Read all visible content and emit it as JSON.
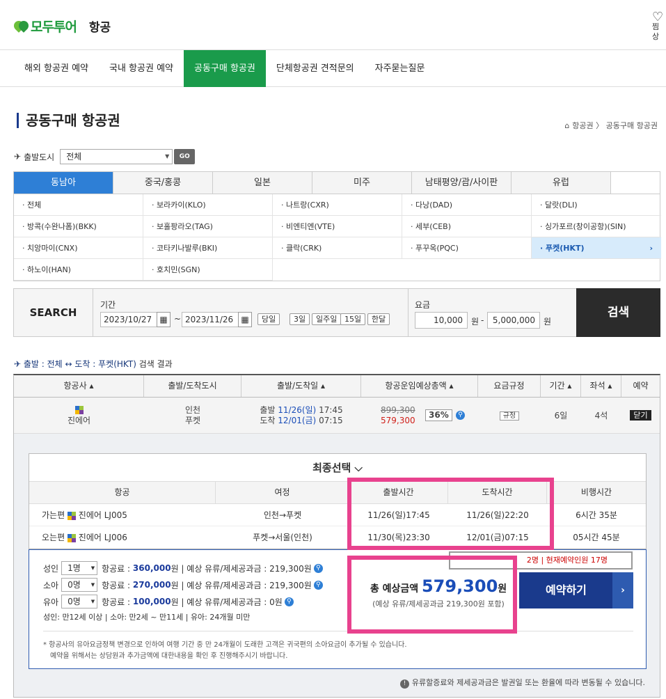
{
  "header": {
    "logo": "모두투어",
    "sub": "항공",
    "wish_label": "찜상"
  },
  "gnb": [
    "해외 항공권 예약",
    "국내 항공권 예약",
    "공동구매 항공권",
    "단체항공권 견적문의",
    "자주묻는질문"
  ],
  "page_title": "공동구매 항공권",
  "breadcrumb": {
    "home": "⌂",
    "path": "항공권 〉 공동구매 항공권"
  },
  "city": {
    "label": "출발도시",
    "value": "전체",
    "go": "GO"
  },
  "region_tabs": [
    "동남아",
    "중국/홍콩",
    "일본",
    "미주",
    "남태평양/괌/사이판",
    "유럽"
  ],
  "cities": [
    "· 전체",
    "· 보라카이(KLO)",
    "· 나트랑(CXR)",
    "· 다낭(DAD)",
    "· 달랏(DLI)",
    "· 방콕(수완나폼)(BKK)",
    "· 보홀팡라오(TAG)",
    "· 비엔티엔(VTE)",
    "· 세부(CEB)",
    "· 싱가포르(창이공항)(SIN)",
    "· 치앙마이(CNX)",
    "· 코타키나발루(BKI)",
    "· 클락(CRK)",
    "· 푸꾸옥(PQC)",
    "· 푸켓(HKT)",
    "· 하노이(HAN)",
    "· 호치민(SGN)"
  ],
  "search": {
    "label": "SEARCH",
    "period_label": "기간",
    "date_from": "2023/10/27",
    "date_to": "2023/11/26",
    "tilde": "~",
    "quick": [
      "당일",
      "3일",
      "일주일",
      "15일",
      "한달"
    ],
    "price_label": "요금",
    "price_min": "10,000",
    "price_max": "5,000,000",
    "unit": "원",
    "dash": "-",
    "button": "검색"
  },
  "result_line": {
    "route": "출발 : 전체 ↔ 도착 : 푸켓(HKT)",
    "rest": " 검색 결과"
  },
  "table": {
    "headers": [
      "항공사 ▴",
      "출발/도착도시",
      "출발/도착일 ▴",
      "항공운임예상총액 ▴",
      "요금규정",
      "기간 ▴",
      "좌석 ▴",
      "예약"
    ],
    "row": {
      "airline": "진에어",
      "dep_city": "인천",
      "arr_city": "푸켓",
      "dep_prefix": "출발",
      "dep_date": "11/26(일)",
      "dep_time": "17:45",
      "arr_prefix": "도착",
      "arr_date": "12/01(금)",
      "arr_time": "07:15",
      "old_price": "899,300",
      "price": "579,300",
      "discount": "36%",
      "rule": "규정",
      "period": "6일",
      "seats": "4석",
      "close": "닫기"
    }
  },
  "final": {
    "title": "최종선택 ⌵",
    "headers": [
      "항공",
      "여정",
      "출발시간",
      "도착시간",
      "비행시간"
    ],
    "rows": [
      {
        "dir": "가는편",
        "flight": "진에어 LJ005",
        "route": "인천→푸켓",
        "dep": "11/26(일)17:45",
        "arr": "11/26(일)22:20",
        "dur": "6시간 35분"
      },
      {
        "dir": "오는편",
        "flight": "진에어 LJ006",
        "route": "푸켓→서울(인천)",
        "dep": "11/30(목)23:30",
        "arr": "12/01(금)07:15",
        "dur": "05시간 45분"
      }
    ]
  },
  "pax": [
    {
      "label": "성인",
      "count": "1명",
      "fare_label": "항공료 :",
      "fare": "360,000",
      "rest": "원 | 예상 유류/제세공과금 : 219,300원"
    },
    {
      "label": "소아",
      "count": "0명",
      "fare_label": "항공료 :",
      "fare": "270,000",
      "rest": "원 | 예상 유류/제세공과금 : 219,300원"
    },
    {
      "label": "유아",
      "count": "0명",
      "fare_label": "항공료 :",
      "fare": "100,000",
      "rest": "원 | 예상 유류/제세공과금 : 0원"
    }
  ],
  "age_note": "성인: 만12세 이상 | 소아: 만2세 ~ 만11세 | 유아: 24개월 미만",
  "total": {
    "label": "총 예상금액",
    "amount": "579,300",
    "unit": "원",
    "sub": "(예상 유류/제세공과금 219,300원 포함)"
  },
  "book": {
    "label": "예약하기",
    "arrow": "›"
  },
  "min_info": "2명 | 현재예약인원 17명",
  "notice": [
    "* 항공사의 유아요금정책 변경으로 인하여 여행 기간 중 만 24개월이 도래한 고객은 귀국편의 소아요금이 추가될 수 있습니다.",
    "예약을 위해서는 상담원과 추가금액에 대한내용을 확인 후 진행해주시기 바랍니다."
  ],
  "fare_note": "유류할증료와 제세공과금은 발권일 또는 환율에 따라 변동될 수 있습니다.",
  "colors": {
    "brand": "#1a9b4b",
    "accent": "#2e7fd6",
    "highlight": "#e8428e",
    "navy": "#1a3a8c"
  }
}
